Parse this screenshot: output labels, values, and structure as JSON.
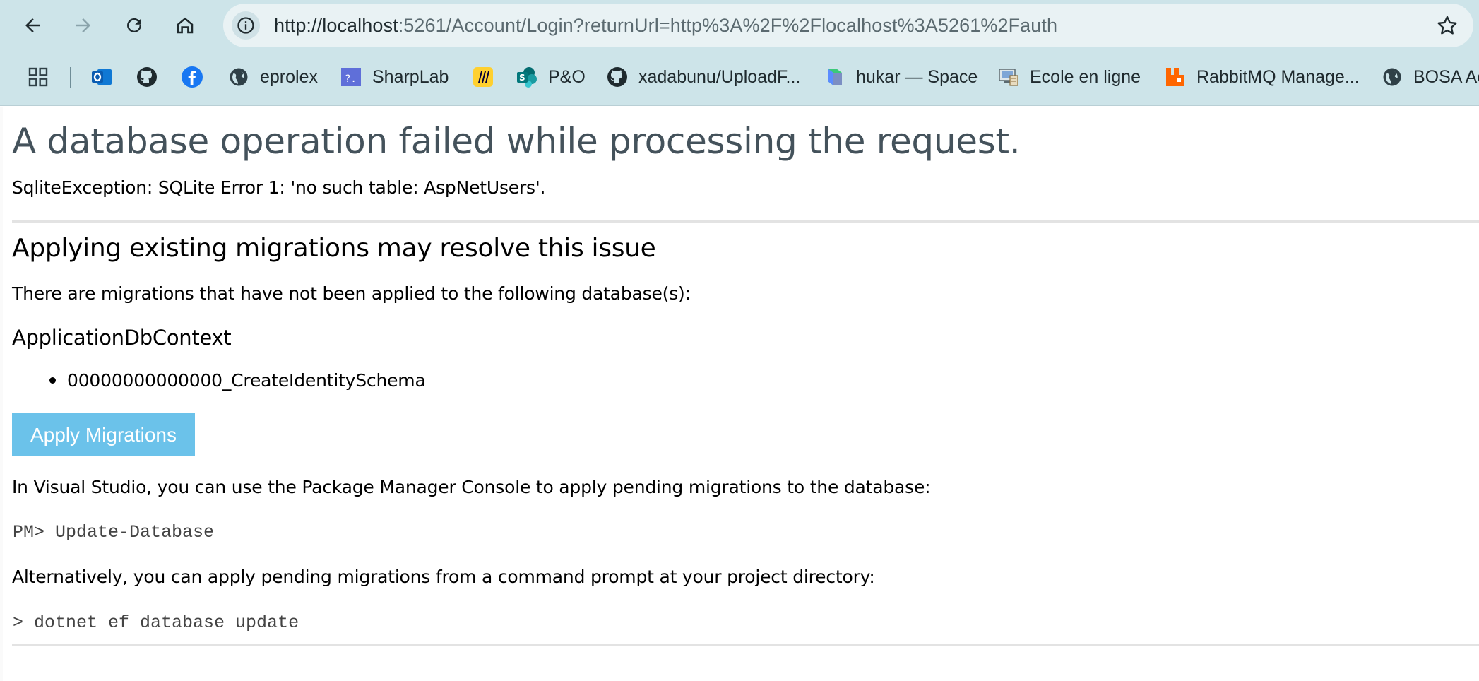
{
  "browser": {
    "url_host": "http://localhost",
    "url_rest": ":5261/Account/Login?returnUrl=http%3A%2F%2Flocalhost%3A5261%2Fauth",
    "icons": {
      "back": "arrow-left-icon",
      "forward": "arrow-right-icon",
      "reload": "reload-icon",
      "home": "home-icon",
      "site_info": "info-icon",
      "bookmark_star": "star-icon",
      "apps": "apps-grid-icon"
    }
  },
  "bookmarks": [
    {
      "label": "",
      "icon": "outlook-icon"
    },
    {
      "label": "",
      "icon": "github-icon"
    },
    {
      "label": "",
      "icon": "facebook-icon"
    },
    {
      "label": "eprolex",
      "icon": "globe-icon"
    },
    {
      "label": "SharpLab",
      "icon": "sharplab-icon"
    },
    {
      "label": "",
      "icon": "miro-icon"
    },
    {
      "label": "P&O",
      "icon": "sharepoint-icon"
    },
    {
      "label": "xadabunu/UploadF...",
      "icon": "github-icon"
    },
    {
      "label": "hukar — Space",
      "icon": "space-icon"
    },
    {
      "label": "Ecole en ligne",
      "icon": "ecole-icon"
    },
    {
      "label": "RabbitMQ Manage...",
      "icon": "rabbitmq-icon"
    },
    {
      "label": "BOSA Ac",
      "icon": "globe-icon"
    }
  ],
  "page": {
    "title": "A database operation failed while processing the request.",
    "error": "SqliteException: SQLite Error 1: 'no such table: AspNetUsers'.",
    "subtitle": "Applying existing migrations may resolve this issue",
    "intro": "There are migrations that have not been applied to the following database(s):",
    "context": "ApplicationDbContext",
    "migrations": [
      "00000000000000_CreateIdentitySchema"
    ],
    "apply_button": "Apply Migrations",
    "vs_text": "In Visual Studio, you can use the Package Manager Console to apply pending migrations to the database:",
    "vs_command": "PM> Update-Database",
    "cli_text": "Alternatively, you can apply pending migrations from a command prompt at your project directory:",
    "cli_command": "> dotnet ef database update"
  },
  "colors": {
    "chrome_bg": "#cde4e9",
    "omnibox_bg": "#e9f2f4",
    "title": "#44525b",
    "button": "#6bc2ea",
    "rule": "#e3e3e3"
  }
}
